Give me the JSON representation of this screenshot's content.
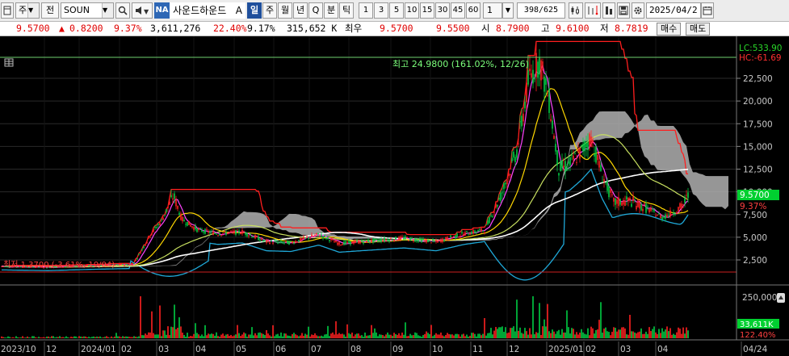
{
  "toolbar": {
    "market_select": "주",
    "market_select_2": "전",
    "symbol": "SOUN",
    "brand_badge": "NA",
    "stock_name": "사운드하운드",
    "stock_name_suffix": "A",
    "period_tabs": [
      "일",
      "주",
      "월",
      "년",
      "Q",
      "분",
      "틱"
    ],
    "active_period": "일",
    "interval_buttons": [
      "1",
      "3",
      "5",
      "10",
      "15",
      "30",
      "45",
      "60"
    ],
    "interval_value": "1",
    "page_counter": "398/625",
    "date": "2025/04/2"
  },
  "info": {
    "price": "9.5700",
    "change_sign": "▲",
    "change": "0.8200",
    "change_pct": "9.37%",
    "volume": "3,611,276",
    "volume_pct": "22.40%",
    "turnover": "9.17%",
    "amount": "315,652 K",
    "ask_label": "최우",
    "ask": "9.5700",
    "bid": "9.5500",
    "open_label": "시",
    "open": "8.7900",
    "high_label": "고",
    "high": "9.6100",
    "low_label": "저",
    "low": "8.7819",
    "buy_label": "매수",
    "sell_label": "매도"
  },
  "chart": {
    "high_annotation": "최고 24.9800 (161.02%, 12/26)",
    "lc_label": "LC:533.90",
    "hc_label": "HC:-61.69",
    "price_ticks": [
      "22,500",
      "20,000",
      "17,500",
      "15,000",
      "12,500",
      "10,000",
      "7,500",
      "5,000",
      "2,500"
    ],
    "current_price_label": "9.5700",
    "current_pct_label": "9.37%",
    "volume_ticks": [
      "250,000K"
    ],
    "volume_value_label": "33,611K",
    "volume_pct_label": "122.40%",
    "low_annotation": "최저 1.3700 (-3.61%, 10/04)",
    "x_labels": [
      "2023/10",
      "12",
      "2024/01",
      "02",
      "03",
      "04",
      "05",
      "06",
      "07",
      "08",
      "09",
      "10",
      "11",
      "12",
      "2025/01",
      "02",
      "03",
      "04",
      "04/24"
    ],
    "colors": {
      "up": "#ff2020",
      "down": "#00cc44",
      "grid": "#2a2a2a",
      "axis_text": "#c8c8c8",
      "ma5": "#ff44ff",
      "ma20": "#ffd700",
      "ma60": "#c8e060",
      "ma120": "#ffffff",
      "trend_red": "#ff1e1e",
      "trend_blue": "#1fa8d8",
      "cloud": "#b0b0b0"
    }
  }
}
